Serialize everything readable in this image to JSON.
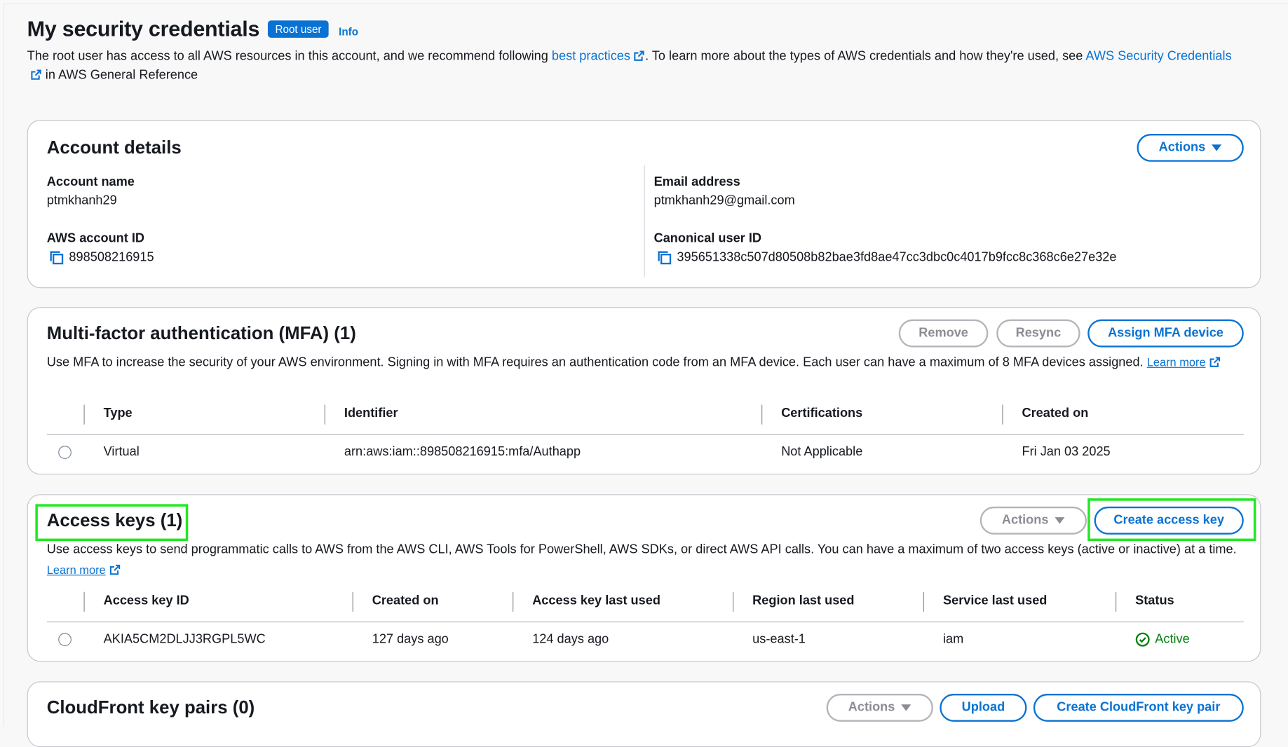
{
  "header": {
    "title": "My security credentials",
    "badge": "Root user",
    "info": "Info",
    "intro_prefix": "The root user has access to all AWS resources in this account, and we recommend following ",
    "intro_link1": "best practices",
    "intro_middle": ". To learn more about the types of AWS credentials and how they're used, see ",
    "intro_link2": "AWS Security Credentials",
    "intro_suffix": " in AWS General Reference"
  },
  "account": {
    "title": "Account details",
    "actions_label": "Actions",
    "account_name_label": "Account name",
    "account_name": "ptmkhanh29",
    "email_label": "Email address",
    "email": "ptmkhanh29@gmail.com",
    "account_id_label": "AWS account ID",
    "account_id": "898508216915",
    "canonical_label": "Canonical user ID",
    "canonical_id": "395651338c507d80508b82bae3fd8ae47cc3dbc0c4017b9fcc8c368c6e27e32e"
  },
  "mfa": {
    "title": "Multi-factor authentication (MFA) (1)",
    "remove_label": "Remove",
    "resync_label": "Resync",
    "assign_label": "Assign MFA device",
    "description": "Use MFA to increase the security of your AWS environment. Signing in with MFA requires an authentication code from an MFA device. Each user can have a maximum of 8 MFA devices assigned.",
    "learn_more": "Learn more",
    "columns": [
      "Type",
      "Identifier",
      "Certifications",
      "Created on"
    ],
    "rows": [
      {
        "type": "Virtual",
        "identifier": "arn:aws:iam::898508216915:mfa/Authapp",
        "certifications": "Not Applicable",
        "created_on": "Fri Jan 03 2025"
      }
    ]
  },
  "access_keys": {
    "title": "Access keys (1)",
    "actions_label": "Actions",
    "create_label": "Create access key",
    "description": "Use access keys to send programmatic calls to AWS from the AWS CLI, AWS Tools for PowerShell, AWS SDKs, or direct AWS API calls. You can have a maximum of two access keys (active or inactive) at a time.",
    "learn_more": "Learn more",
    "columns": [
      "Access key ID",
      "Created on",
      "Access key last used",
      "Region last used",
      "Service last used",
      "Status"
    ],
    "rows": [
      {
        "key_id": "AKIA5CM2DLJJ3RGPL5WC",
        "created_on": "127 days ago",
        "last_used": "124 days ago",
        "region": "us-east-1",
        "service": "iam",
        "status": "Active"
      }
    ]
  },
  "cloudfront": {
    "title": "CloudFront key pairs (0)",
    "actions_label": "Actions",
    "upload_label": "Upload",
    "create_label": "Create CloudFront key pair"
  },
  "colors": {
    "link": "#0972d3",
    "highlight": "#22e822",
    "success": "#037f0c",
    "badge_bg": "#0972d3"
  }
}
